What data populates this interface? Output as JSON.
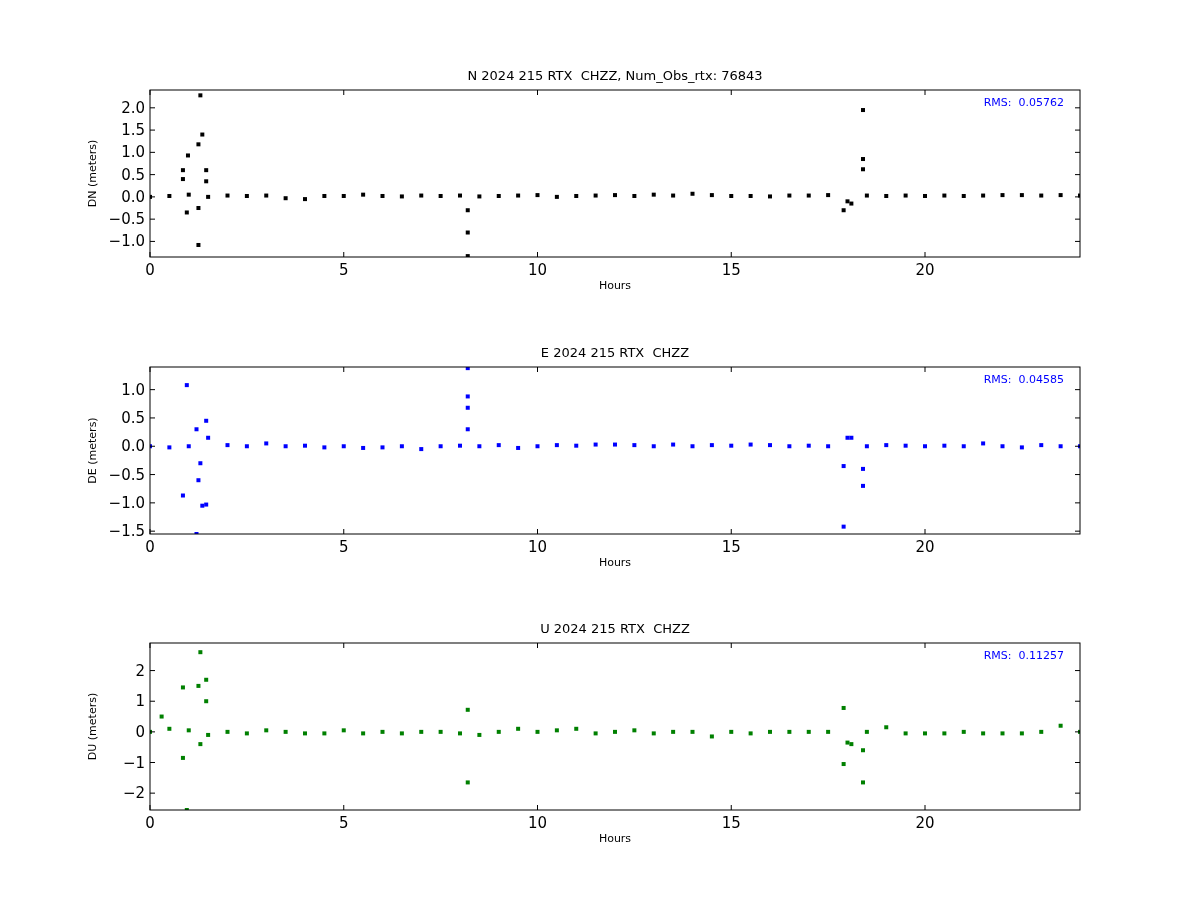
{
  "charts": [
    {
      "chart_data": {
        "type": "scatter",
        "title": "N 2024 215 RTX  CHZZ, Num_Obs_rtx: 76843",
        "xlabel": "Hours",
        "ylabel": "DN (meters)",
        "xlim": [
          0,
          24
        ],
        "ylim": [
          -1.35,
          2.4
        ],
        "xticks": [
          0,
          5,
          10,
          15,
          20
        ],
        "yticks": [
          {
            "value": -1,
            "label": "−1.0"
          },
          {
            "value": -0.5,
            "label": "−0.5"
          },
          {
            "value": 0,
            "label": "0.0"
          },
          {
            "value": 0.5,
            "label": "0.5"
          },
          {
            "value": 1,
            "label": "1.0"
          },
          {
            "value": 1.5,
            "label": "1.5"
          },
          {
            "value": 2,
            "label": "2.0"
          }
        ],
        "annotations": [
          "RMS:  0.05762"
        ],
        "x": [
          0,
          0.5,
          1,
          1.5,
          2,
          2.5,
          3,
          3.5,
          4,
          4.5,
          5,
          5.5,
          6,
          6.5,
          7,
          7.5,
          8,
          8.5,
          9,
          9.5,
          10,
          10.5,
          11,
          11.5,
          12,
          12.5,
          13,
          13.5,
          14,
          14.5,
          15,
          15.5,
          16,
          16.5,
          17,
          17.5,
          18,
          18.5,
          19,
          19.5,
          20,
          20.5,
          21,
          21.5,
          22,
          22.5,
          23,
          23.5,
          24,
          0.85,
          0.85,
          0.95,
          0.98,
          1.25,
          1.25,
          1.3,
          1.35,
          1.45,
          1.45,
          1.25,
          8.2,
          8.2,
          8.2,
          17.9,
          18.4,
          18.4,
          18.4,
          18.1
        ],
        "series": [
          {
            "color": "#000000",
            "values": [
              0.0,
              0.02,
              0.05,
              0.0,
              0.03,
              0.02,
              0.03,
              -0.03,
              -0.05,
              0.02,
              0.02,
              0.05,
              0.02,
              0.01,
              0.03,
              0.02,
              0.03,
              0.01,
              0.02,
              0.03,
              0.04,
              0.0,
              0.02,
              0.03,
              0.04,
              0.02,
              0.05,
              0.03,
              0.07,
              0.04,
              0.02,
              0.02,
              0.01,
              0.03,
              0.03,
              0.04,
              -0.1,
              0.03,
              0.02,
              0.03,
              0.02,
              0.03,
              0.02,
              0.03,
              0.04,
              0.04,
              0.03,
              0.04,
              0.03,
              0.6,
              0.4,
              -0.35,
              0.93,
              1.18,
              -1.08,
              2.28,
              1.4,
              0.6,
              0.35,
              -0.25,
              -0.3,
              -0.8,
              -1.33,
              -0.3,
              1.95,
              0.85,
              0.62,
              -0.15
            ]
          }
        ]
      }
    },
    {
      "chart_data": {
        "type": "scatter",
        "title": "E 2024 215 RTX  CHZZ",
        "xlabel": "Hours",
        "ylabel": "DE (meters)",
        "xlim": [
          0,
          24
        ],
        "ylim": [
          -1.55,
          1.4
        ],
        "xticks": [
          0,
          5,
          10,
          15,
          20
        ],
        "yticks": [
          {
            "value": -1.5,
            "label": "−1.5"
          },
          {
            "value": -1,
            "label": "−1.0"
          },
          {
            "value": -0.5,
            "label": "−0.5"
          },
          {
            "value": 0,
            "label": "0.0"
          },
          {
            "value": 0.5,
            "label": "0.5"
          },
          {
            "value": 1,
            "label": "1.0"
          }
        ],
        "annotations": [
          "RMS:  0.04585"
        ],
        "x": [
          0,
          0.5,
          1,
          1.5,
          2,
          2.5,
          3,
          3.5,
          4,
          4.5,
          5,
          5.5,
          6,
          6.5,
          7,
          7.5,
          8,
          8.5,
          9,
          9.5,
          10,
          10.5,
          11,
          11.5,
          12,
          12.5,
          13,
          13.5,
          14,
          14.5,
          15,
          15.5,
          16,
          16.5,
          17,
          17.5,
          18,
          18.5,
          19,
          19.5,
          20,
          20.5,
          21,
          21.5,
          22,
          22.5,
          23,
          23.5,
          24,
          0.85,
          0.95,
          1.2,
          1.25,
          1.3,
          1.35,
          1.45,
          1.45,
          1.2,
          8.2,
          8.2,
          8.2,
          8.2,
          17.9,
          17.9,
          18.4,
          18.4,
          18.1
        ],
        "series": [
          {
            "color": "#0000ff",
            "values": [
              0.0,
              -0.02,
              0.0,
              0.15,
              0.02,
              0.0,
              0.05,
              0.0,
              0.01,
              -0.02,
              0.0,
              -0.03,
              -0.02,
              0.0,
              -0.05,
              0.0,
              0.01,
              0.0,
              0.02,
              -0.03,
              0.0,
              0.02,
              0.01,
              0.03,
              0.03,
              0.02,
              0.0,
              0.03,
              0.0,
              0.02,
              0.01,
              0.03,
              0.02,
              0.0,
              0.01,
              0.0,
              0.15,
              0.0,
              0.02,
              0.01,
              0.0,
              0.01,
              0.0,
              0.05,
              0.0,
              -0.02,
              0.02,
              0.0,
              0.0,
              -0.87,
              1.08,
              -1.55,
              -0.6,
              -0.3,
              -1.05,
              -1.03,
              0.45,
              0.3,
              0.88,
              0.68,
              0.3,
              1.38,
              -1.42,
              -0.35,
              -0.7,
              -0.4,
              0.15
            ]
          }
        ]
      }
    },
    {
      "chart_data": {
        "type": "scatter",
        "title": "U 2024 215 RTX  CHZZ",
        "xlabel": "Hours",
        "ylabel": "DU (meters)",
        "xlim": [
          0,
          24
        ],
        "ylim": [
          -2.55,
          2.9
        ],
        "xticks": [
          0,
          5,
          10,
          15,
          20
        ],
        "yticks": [
          {
            "value": -2,
            "label": "−2"
          },
          {
            "value": -1,
            "label": "−1"
          },
          0,
          1,
          2
        ],
        "annotations": [
          "RMS:  0.11257"
        ],
        "x": [
          0,
          0.5,
          1,
          1.5,
          2,
          2.5,
          3,
          3.5,
          4,
          4.5,
          5,
          5.5,
          6,
          6.5,
          7,
          7.5,
          8,
          8.5,
          9,
          9.5,
          10,
          10.5,
          11,
          11.5,
          12,
          12.5,
          13,
          13.5,
          14,
          14.5,
          15,
          15.5,
          16,
          16.5,
          17,
          17.5,
          18,
          18.5,
          19,
          19.5,
          20,
          20.5,
          21,
          21.5,
          22,
          22.5,
          23,
          23.5,
          24,
          0.85,
          0.85,
          0.95,
          1.3,
          1.25,
          1.3,
          1.45,
          1.45,
          0.3,
          8.2,
          8.2,
          17.9,
          17.9,
          18.4,
          18.4,
          18.1
        ],
        "series": [
          {
            "color": "#008000",
            "values": [
              0.0,
              0.1,
              0.05,
              -0.1,
              0.0,
              -0.05,
              0.05,
              0.0,
              -0.05,
              -0.05,
              0.05,
              -0.05,
              0.0,
              -0.05,
              0.0,
              0.0,
              -0.05,
              -0.1,
              0.0,
              0.1,
              0.0,
              0.05,
              0.1,
              -0.05,
              0.0,
              0.05,
              -0.05,
              0.0,
              0.0,
              -0.15,
              0.0,
              -0.05,
              0.0,
              0.0,
              0.0,
              0.0,
              -0.35,
              0.0,
              0.15,
              -0.05,
              -0.05,
              -0.05,
              0.0,
              -0.05,
              -0.05,
              -0.05,
              0.0,
              0.2,
              0.0,
              1.45,
              -0.85,
              -2.55,
              2.6,
              1.5,
              -0.4,
              1.7,
              1.0,
              0.5,
              0.72,
              -1.65,
              0.78,
              -1.05,
              -1.65,
              -0.6,
              -0.4
            ]
          }
        ]
      }
    }
  ]
}
